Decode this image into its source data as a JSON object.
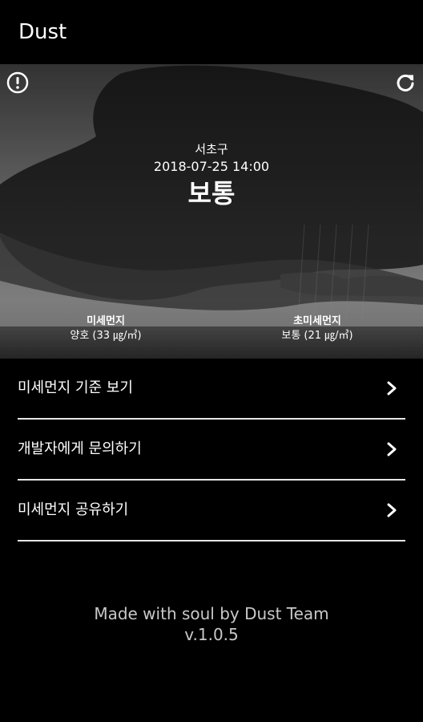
{
  "app": {
    "title": "Dust"
  },
  "hero": {
    "district": "서초구",
    "datetime": "2018-07-25 14:00",
    "status": "보통",
    "info_icon": "info-circle-icon",
    "refresh_icon": "refresh-icon",
    "metrics": [
      {
        "label": "미세먼지",
        "value": "양호 (33 ㎍/㎥)"
      },
      {
        "label": "초미세먼지",
        "value": "보통 (21 ㎍/㎥)"
      }
    ]
  },
  "menu": {
    "items": [
      {
        "label": "미세먼지 기준 보기",
        "icon": "chevron-right-icon"
      },
      {
        "label": "개발자에게 문의하기",
        "icon": "chevron-right-icon"
      },
      {
        "label": "미세먼지 공유하기",
        "icon": "chevron-right-icon"
      }
    ]
  },
  "footer": {
    "credit": "Made with soul by Dust Team",
    "version": "v.1.0.5"
  },
  "colors": {
    "background": "#000000",
    "text": "#ffffff",
    "footer_text": "#c8c8c8",
    "divider": "#e6e6e6"
  }
}
